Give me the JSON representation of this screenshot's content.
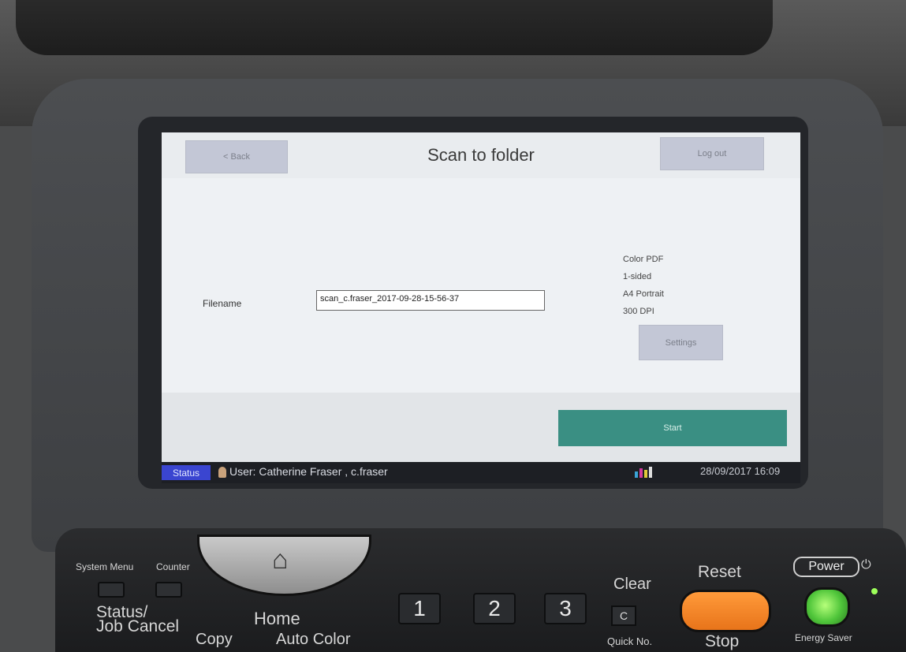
{
  "screen": {
    "title": "Scan to folder",
    "back_label": "< Back",
    "logout_label": "Log out",
    "filename_label": "Filename",
    "filename_value": "scan_c.fraser_2017-09-28-15-56-37",
    "settings_summary": [
      "Color PDF",
      "1-sided",
      "A4 Portrait",
      "300 DPI"
    ],
    "settings_button": "Settings",
    "start_button": "Start"
  },
  "statusbar": {
    "status_label": "Status",
    "user_text": "User: Catherine Fraser , c.fraser",
    "datetime": "28/09/2017 16:09"
  },
  "panel": {
    "system_menu": "System Menu",
    "counter": "Counter",
    "status_job_cancel": [
      "Status/",
      "Job Cancel"
    ],
    "home": "Home",
    "copy": "Copy",
    "auto_color": "Auto Color",
    "keys": [
      "1",
      "2",
      "3"
    ],
    "clear": "Clear",
    "clear_key": "C",
    "quick_no": "Quick No.",
    "reset": "Reset",
    "stop": "Stop",
    "power": "Power",
    "energy_saver": "Energy Saver"
  },
  "colors": {
    "start": "#3a8f83",
    "status": "#3a45d0",
    "reset": "#ff9a3a",
    "power": "#4fc53a"
  },
  "icons": [
    "home-icon",
    "user-icon",
    "power-icon"
  ]
}
